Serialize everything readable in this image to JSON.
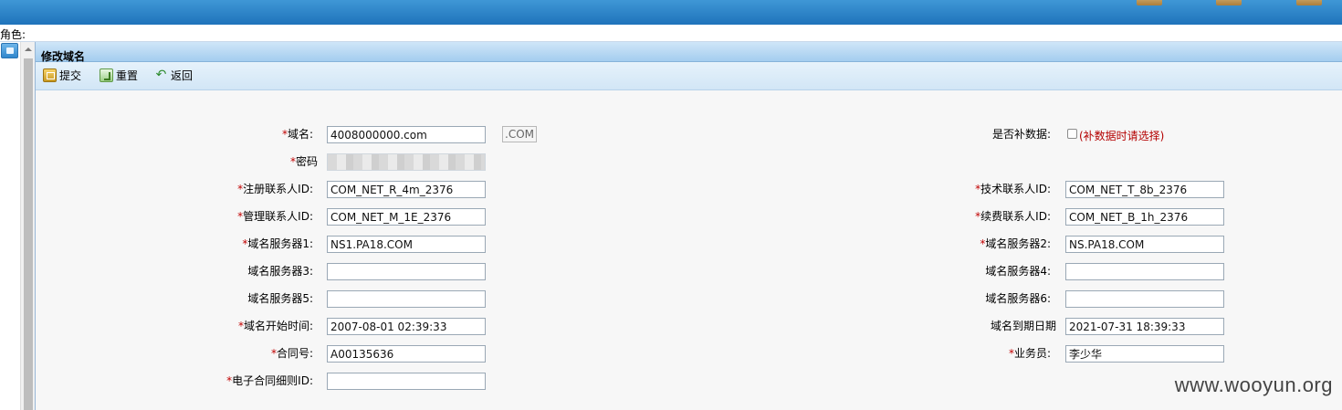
{
  "header": {
    "role_label": "角色:"
  },
  "panel": {
    "title": "修改域名",
    "toolbar": {
      "submit": "提交",
      "reset": "重置",
      "back": "返回"
    }
  },
  "form": {
    "domain": {
      "label": "域名:",
      "value": "4008000000.com",
      "suffix": ".COM"
    },
    "supplement": {
      "label": "是否补数据:",
      "note": "(补数据时请选择)",
      "checked": false
    },
    "password": {
      "label": "密码"
    },
    "reg_contact": {
      "label": "注册联系人ID:",
      "value": "COM_NET_R_4m_2376"
    },
    "tech_contact": {
      "label": "技术联系人ID:",
      "value": "COM_NET_T_8b_2376"
    },
    "admin_contact": {
      "label": "管理联系人ID:",
      "value": "COM_NET_M_1E_2376"
    },
    "billing_contact": {
      "label": "续费联系人ID:",
      "value": "COM_NET_B_1h_2376"
    },
    "ns1": {
      "label": "域名服务器1:",
      "value": "NS1.PA18.COM"
    },
    "ns2": {
      "label": "域名服务器2:",
      "value": "NS.PA18.COM"
    },
    "ns3": {
      "label": "域名服务器3:",
      "value": ""
    },
    "ns4": {
      "label": "域名服务器4:",
      "value": ""
    },
    "ns5": {
      "label": "域名服务器5:",
      "value": ""
    },
    "ns6": {
      "label": "域名服务器6:",
      "value": ""
    },
    "start_time": {
      "label": "域名开始时间:",
      "value": "2007-08-01 02:39:33"
    },
    "expire_date": {
      "label": "域名到期日期",
      "value": "2021-07-31 18:39:33"
    },
    "contract_no": {
      "label": "合同号:",
      "value": "A00135636"
    },
    "salesperson": {
      "label": "业务员:",
      "value": "李少华"
    },
    "e_contract": {
      "label": "电子合同细则ID:",
      "value": ""
    }
  },
  "required_mark": "*",
  "watermark": "www.wooyun.org"
}
